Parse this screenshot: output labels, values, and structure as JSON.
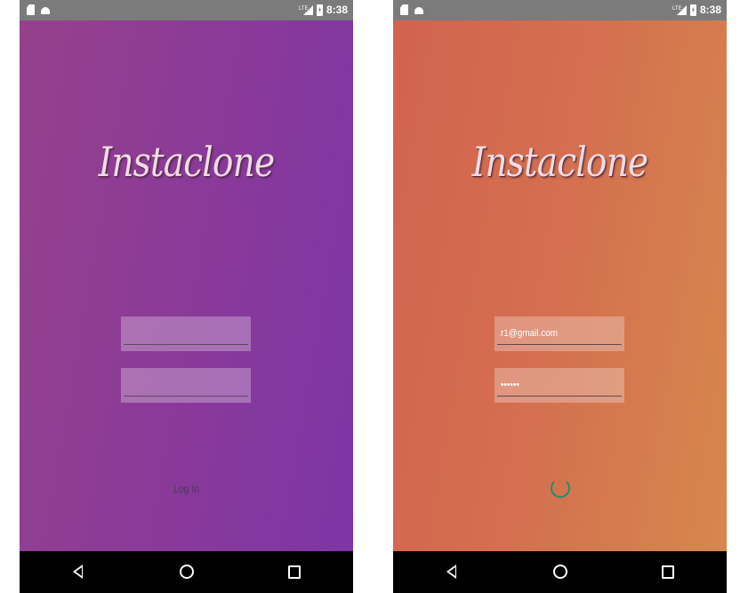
{
  "status_bar": {
    "time": "8:38",
    "network": "LTE"
  },
  "screens": [
    {
      "logo": "Instaclone",
      "email_value": "",
      "password_value": "",
      "login_label": "Log In",
      "background": [
        "#96418d",
        "#7d35a7"
      ]
    },
    {
      "logo": "Instaclone",
      "email_value": "r1@gmail.com",
      "password_value": "••••••",
      "loading": true,
      "background": [
        "#d2634f",
        "#d6874e"
      ]
    }
  ],
  "nav_bar": {
    "icons": [
      "back-icon",
      "home-icon",
      "recents-icon"
    ]
  },
  "colors": {
    "spinner": "#1a8f6b",
    "status_bar": "#7b7b7b",
    "nav_bar": "#000000"
  }
}
